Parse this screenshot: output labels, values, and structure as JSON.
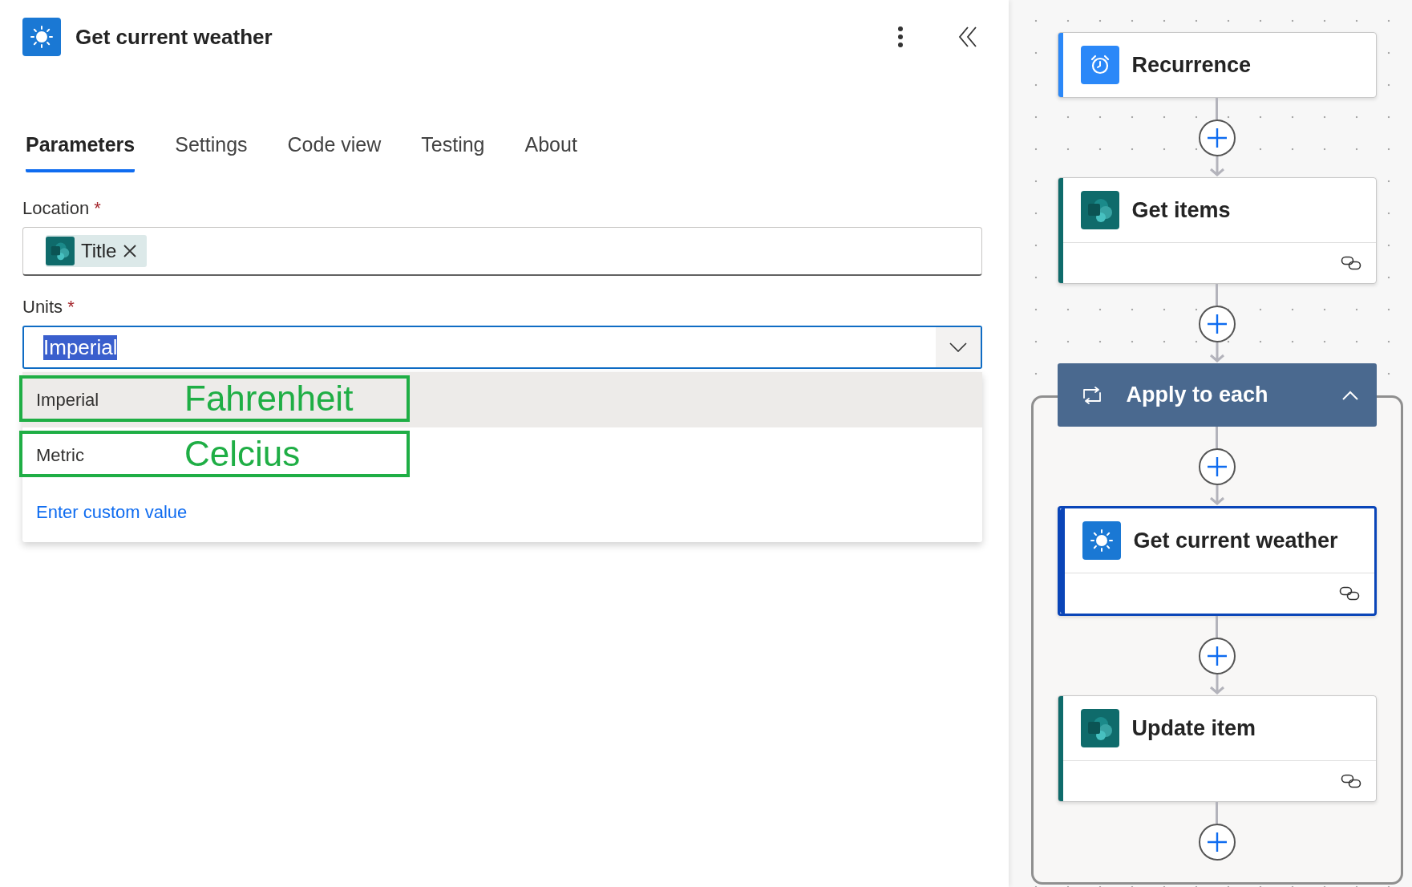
{
  "panel": {
    "title": "Get current weather",
    "tabs": [
      {
        "label": "Parameters",
        "selected": true
      },
      {
        "label": "Settings",
        "selected": false
      },
      {
        "label": "Code view",
        "selected": false
      },
      {
        "label": "Testing",
        "selected": false
      },
      {
        "label": "About",
        "selected": false
      }
    ],
    "fields": [
      {
        "kind": "tokens",
        "label": "Location",
        "required_mark": "*",
        "tokens": [
          {
            "label": "Title"
          }
        ]
      },
      {
        "kind": "dropdown",
        "label": "Units",
        "required_mark": "*",
        "value": "Imperial",
        "value_selected": true,
        "expanded": true,
        "options": [
          {
            "label": "Imperial",
            "highlighted": true,
            "annotation": "Fahrenheit"
          },
          {
            "label": "Metric",
            "highlighted": false,
            "annotation": "Celcius"
          }
        ],
        "custom_action": "Enter custom value"
      }
    ]
  },
  "flow": {
    "steps": [
      {
        "kind": "schedule",
        "title": "Recurrence",
        "selected": false,
        "linked": false
      },
      {
        "kind": "sharepoint",
        "title": "Get items",
        "selected": false,
        "linked": true
      },
      {
        "kind": "loop",
        "title": "Apply to each",
        "expanded": true,
        "children": [
          {
            "kind": "weather",
            "title": "Get current weather",
            "selected": true,
            "linked": true
          },
          {
            "kind": "sharepoint",
            "title": "Update item",
            "selected": false,
            "linked": true
          }
        ]
      }
    ]
  }
}
